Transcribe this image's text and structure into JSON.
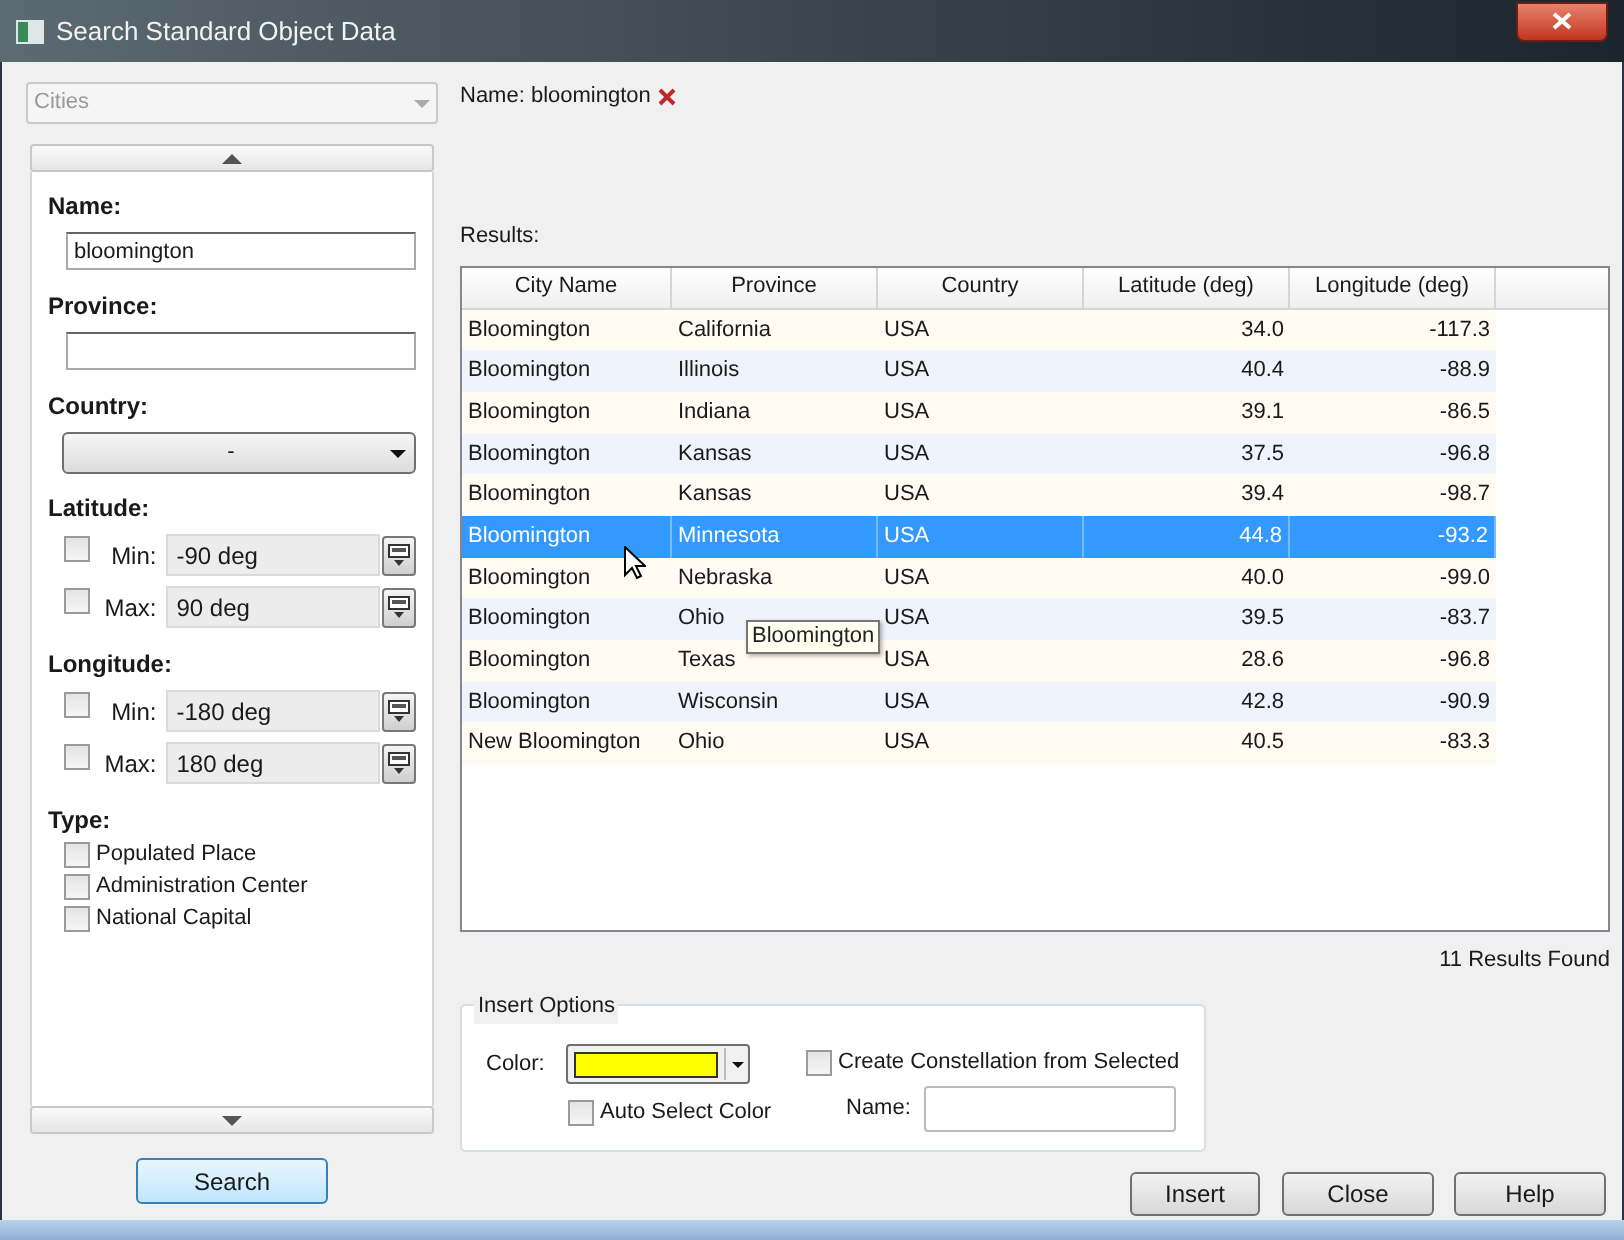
{
  "window": {
    "title": "Search Standard Object Data"
  },
  "left_panel": {
    "category": {
      "value": "Cities"
    },
    "name": {
      "label": "Name:",
      "value": "bloomington"
    },
    "province": {
      "label": "Province:"
    },
    "country": {
      "label": "Country:",
      "value": "-"
    },
    "ranges": [
      {
        "label": "Latitude:",
        "rows": [
          {
            "label": "Min:",
            "value": "-90 deg",
            "checked": false
          },
          {
            "label": "Max:",
            "value": "90 deg",
            "checked": false
          }
        ]
      },
      {
        "label": "Longitude:",
        "rows": [
          {
            "label": "Min:",
            "value": "-180 deg",
            "checked": false
          },
          {
            "label": "Max:",
            "value": "180 deg",
            "checked": false
          }
        ]
      }
    ],
    "type": {
      "label": "Type:",
      "options": [
        {
          "label": "Populated Place",
          "checked": false
        },
        {
          "label": "Administration Center",
          "checked": false
        },
        {
          "label": "National Capital",
          "checked": false
        }
      ]
    },
    "search_button": "Search"
  },
  "filter": {
    "text": "Name: bloomington"
  },
  "results": {
    "label": "Results:",
    "columns": [
      "City Name",
      "Province",
      "Country",
      "Latitude (deg)",
      "Longitude (deg)"
    ],
    "rows": [
      {
        "cells": [
          "Bloomington",
          "California",
          "USA",
          "34.0",
          "-117.3"
        ],
        "selected": false
      },
      {
        "cells": [
          "Bloomington",
          "Illinois",
          "USA",
          "40.4",
          "-88.9"
        ],
        "selected": false
      },
      {
        "cells": [
          "Bloomington",
          "Indiana",
          "USA",
          "39.1",
          "-86.5"
        ],
        "selected": false
      },
      {
        "cells": [
          "Bloomington",
          "Kansas",
          "USA",
          "37.5",
          "-96.8"
        ],
        "selected": false
      },
      {
        "cells": [
          "Bloomington",
          "Kansas",
          "USA",
          "39.4",
          "-98.7"
        ],
        "selected": false
      },
      {
        "cells": [
          "Bloomington",
          "Minnesota",
          "USA",
          "44.8",
          "-93.2"
        ],
        "selected": true
      },
      {
        "cells": [
          "Bloomington",
          "Nebraska",
          "USA",
          "40.0",
          "-99.0"
        ],
        "selected": false
      },
      {
        "cells": [
          "Bloomington",
          "Ohio",
          "USA",
          "39.5",
          "-83.7"
        ],
        "selected": false
      },
      {
        "cells": [
          "Bloomington",
          "Texas",
          "USA",
          "28.6",
          "-96.8"
        ],
        "selected": false
      },
      {
        "cells": [
          "Bloomington",
          "Wisconsin",
          "USA",
          "42.8",
          "-90.9"
        ],
        "selected": false
      },
      {
        "cells": [
          "New Bloomington",
          "Ohio",
          "USA",
          "40.5",
          "-83.3"
        ],
        "selected": false
      }
    ],
    "tooltip": "Bloomington",
    "count": "11 Results Found"
  },
  "insert_options": {
    "title": "Insert Options",
    "color_label": "Color:",
    "color": "#ffff00",
    "auto_select": {
      "label": "Auto Select Color",
      "checked": false
    },
    "constellation": {
      "label": "Create Constellation from Selected",
      "checked": false
    },
    "name_label": "Name:"
  },
  "buttons": [
    "Insert",
    "Close",
    "Help"
  ]
}
